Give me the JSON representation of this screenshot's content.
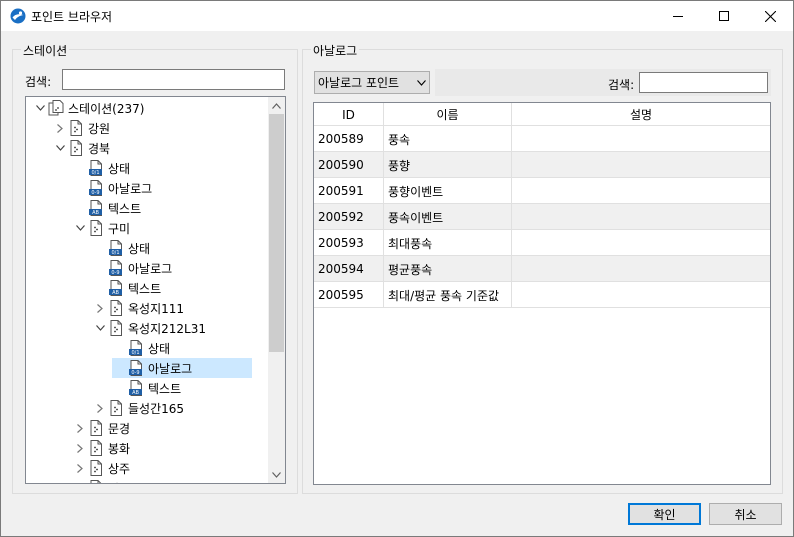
{
  "window": {
    "title": "포인트 브라우저"
  },
  "left_panel": {
    "group_label": "스테이션",
    "search_label": "검색:",
    "search_value": "",
    "tree": [
      {
        "label": "스테이션(237)",
        "depth": 0,
        "expander": "expanded",
        "icon": "station-folder",
        "selected": false
      },
      {
        "label": "강원",
        "depth": 1,
        "expander": "collapsed",
        "icon": "folder-doc",
        "selected": false
      },
      {
        "label": "경북",
        "depth": 1,
        "expander": "expanded",
        "icon": "folder-doc",
        "selected": false
      },
      {
        "label": "상태",
        "depth": 2,
        "expander": "none",
        "icon": "status",
        "selected": false
      },
      {
        "label": "아날로그",
        "depth": 2,
        "expander": "none",
        "icon": "analog",
        "selected": false
      },
      {
        "label": "텍스트",
        "depth": 2,
        "expander": "none",
        "icon": "text",
        "selected": false
      },
      {
        "label": "구미",
        "depth": 2,
        "expander": "expanded",
        "icon": "folder-doc",
        "selected": false
      },
      {
        "label": "상태",
        "depth": 3,
        "expander": "none",
        "icon": "status",
        "selected": false
      },
      {
        "label": "아날로그",
        "depth": 3,
        "expander": "none",
        "icon": "analog",
        "selected": false
      },
      {
        "label": "텍스트",
        "depth": 3,
        "expander": "none",
        "icon": "text",
        "selected": false
      },
      {
        "label": "옥성지111",
        "depth": 3,
        "expander": "collapsed",
        "icon": "folder-doc",
        "selected": false
      },
      {
        "label": "옥성지212L31",
        "depth": 3,
        "expander": "expanded",
        "icon": "folder-doc",
        "selected": false
      },
      {
        "label": "상태",
        "depth": 4,
        "expander": "none",
        "icon": "status",
        "selected": false
      },
      {
        "label": "아날로그",
        "depth": 4,
        "expander": "none",
        "icon": "analog",
        "selected": true
      },
      {
        "label": "텍스트",
        "depth": 4,
        "expander": "none",
        "icon": "text",
        "selected": false
      },
      {
        "label": "들성간165",
        "depth": 3,
        "expander": "collapsed",
        "icon": "folder-doc",
        "selected": false
      },
      {
        "label": "문경",
        "depth": 2,
        "expander": "collapsed",
        "icon": "folder-doc",
        "selected": false
      },
      {
        "label": "봉화",
        "depth": 2,
        "expander": "collapsed",
        "icon": "folder-doc",
        "selected": false
      },
      {
        "label": "상주",
        "depth": 2,
        "expander": "collapsed",
        "icon": "folder-doc",
        "selected": false
      },
      {
        "label": "영주",
        "depth": 2,
        "expander": "collapsed",
        "icon": "folder-doc",
        "selected": false
      }
    ]
  },
  "right_panel": {
    "group_label": "아날로그",
    "filter_selected": "아날로그 포인트",
    "search_label": "검색:",
    "search_value": "",
    "columns": [
      "ID",
      "이름",
      "설명"
    ],
    "rows": [
      {
        "id": "200589",
        "name": "풍속",
        "desc": ""
      },
      {
        "id": "200590",
        "name": "풍향",
        "desc": ""
      },
      {
        "id": "200591",
        "name": "풍향이벤트",
        "desc": ""
      },
      {
        "id": "200592",
        "name": "풍속이벤트",
        "desc": ""
      },
      {
        "id": "200593",
        "name": "최대풍속",
        "desc": ""
      },
      {
        "id": "200594",
        "name": "평균풍속",
        "desc": ""
      },
      {
        "id": "200595",
        "name": "최대/평균 풍속 기준값",
        "desc": ""
      }
    ]
  },
  "buttons": {
    "ok": "확인",
    "cancel": "취소"
  },
  "colors": {
    "selection": "#cce8ff",
    "default_button_border": "#0078d7",
    "icon_blue": "#1f5fa6"
  }
}
